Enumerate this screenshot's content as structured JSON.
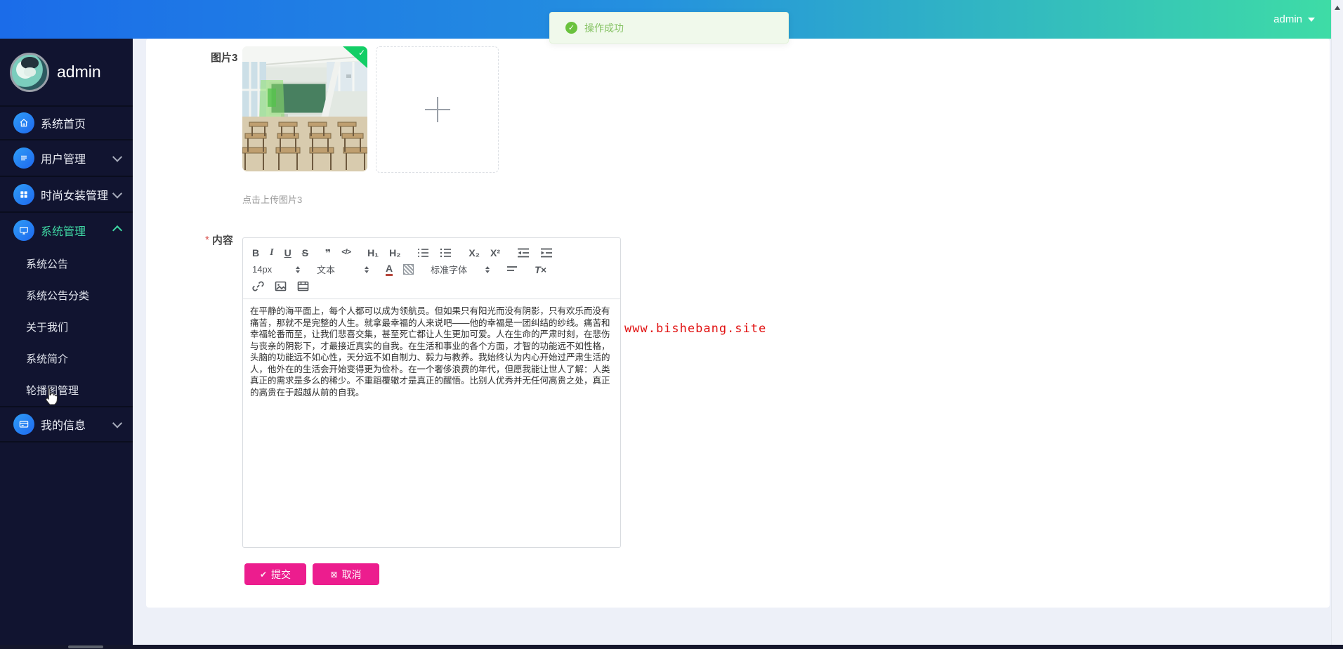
{
  "topbar": {
    "user": "admin",
    "toast_text": "操作成功"
  },
  "sidebar": {
    "name": "admin",
    "items": [
      {
        "label": "系统首页",
        "icon": "home-icon"
      },
      {
        "label": "用户管理",
        "icon": "list-icon"
      },
      {
        "label": "时尚女装管理",
        "icon": "grid-icon"
      },
      {
        "label": "系统管理",
        "icon": "monitor-icon"
      },
      {
        "label": "我的信息",
        "icon": "id-card-icon"
      }
    ],
    "submenu": [
      "系统公告",
      "系统公告分类",
      "关于我们",
      "系统简介",
      "轮播图管理"
    ]
  },
  "form": {
    "image_label": "图片3",
    "upload_tip": "点击上传图片3",
    "required_mark": "*",
    "content_label": "内容",
    "submit_label": "提交",
    "cancel_label": "取消"
  },
  "editor": {
    "buttons": {
      "bold": "B",
      "italic": "I",
      "underline": "U",
      "strike": "S",
      "quote": "❞",
      "code": "</>",
      "h1": "H₁",
      "h2": "H₂",
      "sub": "X₂",
      "sup": "X²",
      "clear": "T×"
    },
    "selects": {
      "size": "14px",
      "format": "文本",
      "font": "标准字体"
    },
    "color_letter": "A",
    "content": "在平静的海平面上，每个人都可以成为领航员。但如果只有阳光而没有阴影，只有欢乐而没有痛苦，那就不是完整的人生。就拿最幸福的人来说吧——他的幸福是一团纠结的纱线。痛苦和幸福轮番而至，让我们悲喜交集，甚至死亡都让人生更加可爱。人在生命的严肃时刻，在悲伤与丧亲的阴影下，才最接近真实的自我。在生活和事业的各个方面，才智的功能远不如性格，头脑的功能远不如心性，天分远不如自制力、毅力与教养。我始终认为内心开始过严肃生活的人，他外在的生活会开始变得更为俭朴。在一个奢侈浪费的年代，但愿我能让世人了解：人类真正的需求是多么的稀少。不重蹈覆辙才是真正的醒悟。比别人优秀并无任何高贵之处，真正的高贵在于超越从前的自我。"
  },
  "watermark": "www.bishebang.site",
  "icons": {
    "success_check": "✓",
    "submit_check": "✔",
    "cancel_box": "⊠"
  },
  "colors": {
    "topbar_start": "#1b6ce9",
    "topbar_end": "#3edca6",
    "sidebar_bg": "#111430",
    "accent_teal": "#3fd8a4",
    "button_pink": "#ec1d8e",
    "toast_green": "#6ac23d",
    "badge_green": "#13ce66",
    "watermark_red": "#e11212"
  }
}
